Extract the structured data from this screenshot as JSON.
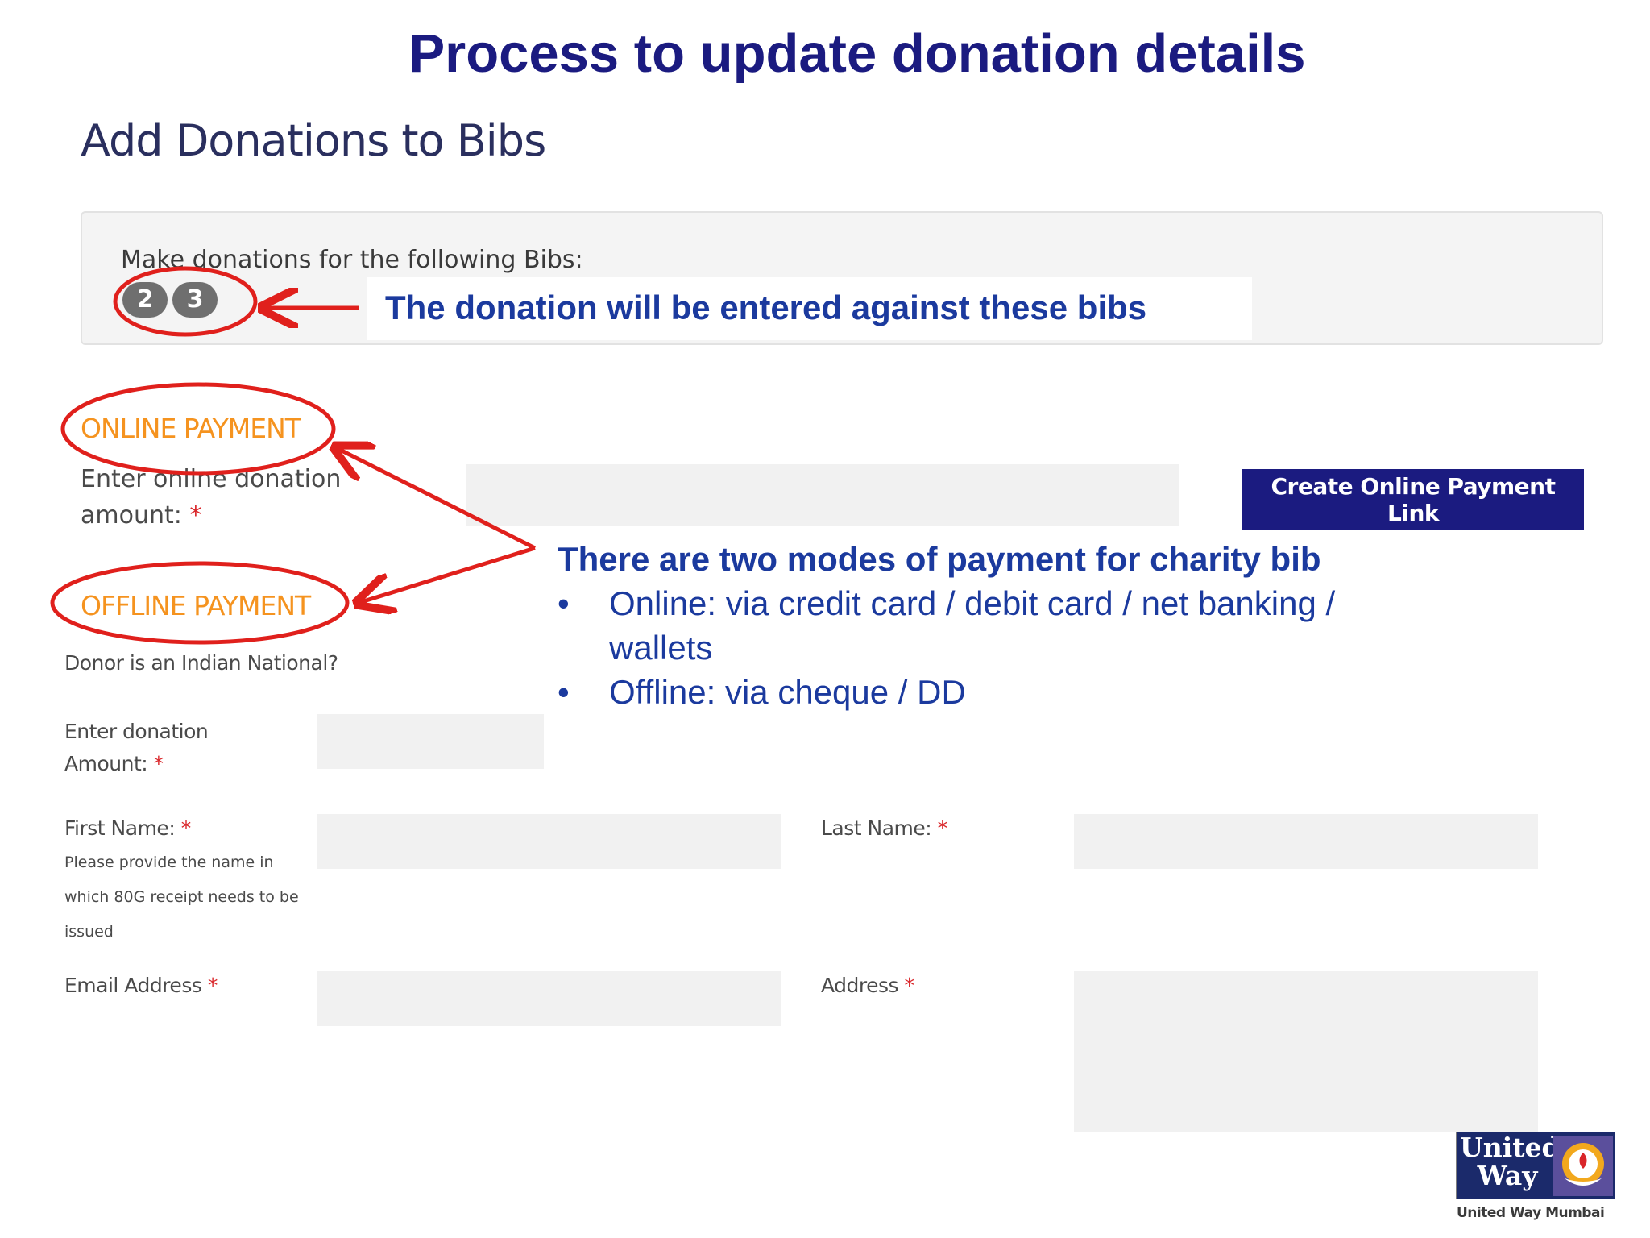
{
  "slide": {
    "title": "Process to update donation details"
  },
  "form": {
    "title": "Add Donations to Bibs",
    "bibs_label": "Make donations for the following Bibs:",
    "bibs": [
      "2",
      "3"
    ],
    "online": {
      "heading": "ONLINE PAYMENT",
      "amount_label_line1": "Enter online donation",
      "amount_label_line2": "amount:",
      "required_mark": "*",
      "amount_value": "",
      "button_label": "Create Online Payment Link"
    },
    "offline": {
      "heading": "OFFLINE PAYMENT",
      "indian_national_label": "Donor is an Indian National?",
      "amount_label_line1": "Enter donation",
      "amount_label_line2": "Amount:",
      "first_name_label": "First Name:",
      "first_name_hint_lines": [
        "Please provide the name in",
        "which 80G receipt needs to be",
        "issued"
      ],
      "last_name_label": "Last Name:",
      "email_label": "Email Address",
      "address_label": "Address",
      "required_mark": "*"
    }
  },
  "annotations": {
    "bibs_callout": "The donation will be entered against these bibs",
    "modes_title": "There are two modes of payment for charity bib",
    "modes": [
      "Online: via credit card / debit card / net banking / wallets",
      "Offline: via cheque / DD"
    ],
    "bullet": "•",
    "annotation_color": "#e0201c"
  },
  "logo": {
    "line1": "United",
    "line2": "Way",
    "caption": "United Way Mumbai",
    "brand_color": "#1b2a6b"
  },
  "icons": {
    "logo_mark": "united-way-hand-icon"
  }
}
